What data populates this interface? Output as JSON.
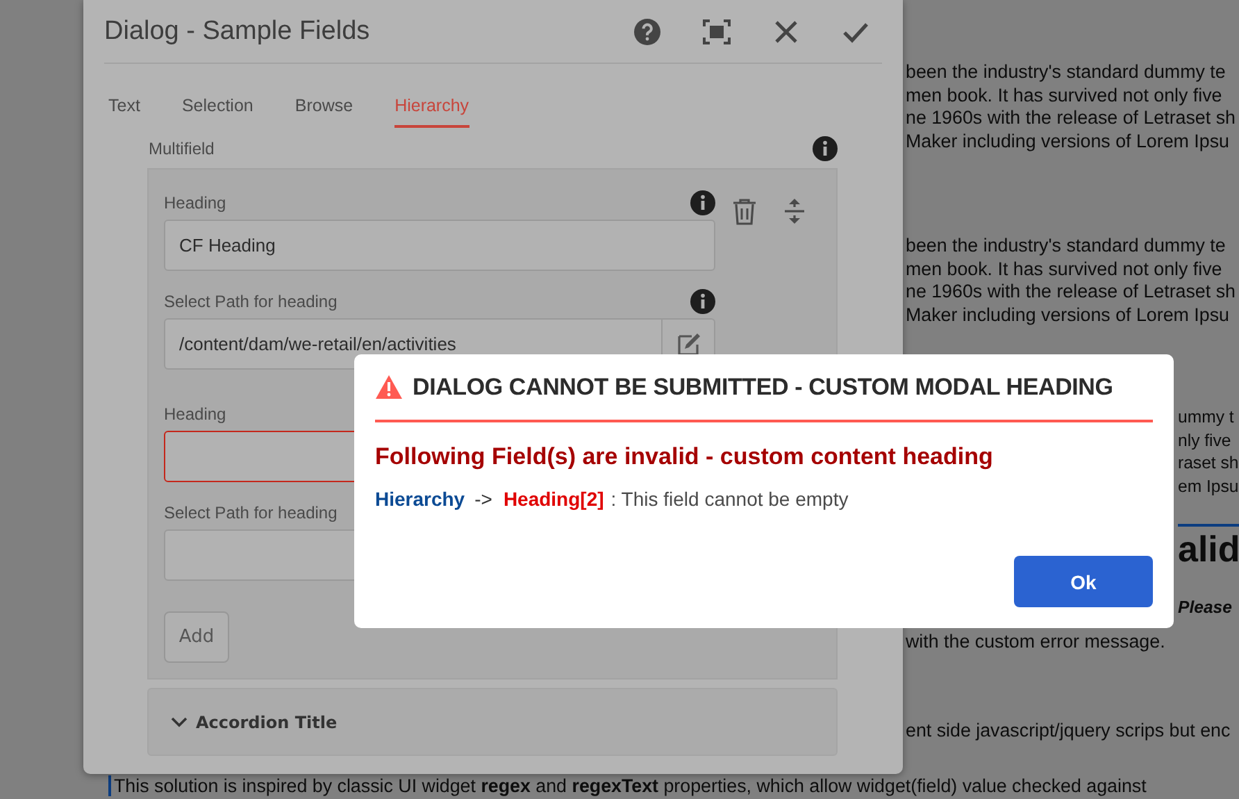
{
  "background_page": [
    {
      "kind": "para",
      "lines": [
        "been the industry's standard dummy te",
        "men book. It has survived not only five",
        "ne 1960s with the release of Letraset sh",
        "Maker including versions of Lorem Ipsu"
      ]
    },
    {
      "kind": "para",
      "lines": [
        "been the industry's standard dummy te",
        "men book. It has survived not only five",
        "ne 1960s with the release of Letraset sh",
        "Maker including versions of Lorem Ipsu"
      ]
    },
    {
      "kind": "para_right",
      "lines": [
        "ummy t",
        "nly five",
        "raset sh",
        "em Ipsu"
      ]
    },
    {
      "kind": "heading_right",
      "lines": [
        "alid"
      ]
    },
    {
      "kind": "emphasis_right",
      "lines": [
        "Please"
      ]
    },
    {
      "kind": "para",
      "lines": [
        "with the custom error message."
      ]
    },
    {
      "kind": "para",
      "lines": [
        "ent side javascript/jquery scrips but enc"
      ]
    },
    {
      "kind": "quote",
      "lines": [
        "This solution is inspired by classic UI widget **regex** and **regexText** properties, which allow widget(field) value checked against"
      ]
    }
  ],
  "dialog": {
    "title": "Dialog - Sample Fields",
    "tabs": [
      {
        "label": "Text",
        "selected": false
      },
      {
        "label": "Selection",
        "selected": false
      },
      {
        "label": "Browse",
        "selected": false
      },
      {
        "label": "Hierarchy",
        "selected": true
      }
    ],
    "multifield": {
      "label": "Multifield",
      "items": [
        {
          "fields": [
            {
              "kind": "text",
              "label": "Heading",
              "value": "CF Heading",
              "invalid": false
            },
            {
              "kind": "path",
              "label": "Select Path for heading",
              "value": "/content/dam/we-retail/en/activities",
              "invalid": false
            }
          ]
        },
        {
          "fields": [
            {
              "kind": "text",
              "label": "Heading",
              "invalid": true
            },
            {
              "kind": "path",
              "label": "Select Path for heading",
              "invalid": false
            }
          ]
        }
      ],
      "add_button": "Add"
    },
    "accordion": {
      "title": "Accordion Title",
      "expanded": false
    }
  },
  "error_modal": {
    "title": "DIALOG CANNOT BE SUBMITTED - CUSTOM MODAL HEADING",
    "heading": "Following Field(s) are invalid - custom content heading",
    "message": {
      "tab": "Hierarchy",
      "separator": "->",
      "field": "Heading[2]",
      "text": ": This field cannot be empty"
    },
    "button": "Ok"
  }
}
